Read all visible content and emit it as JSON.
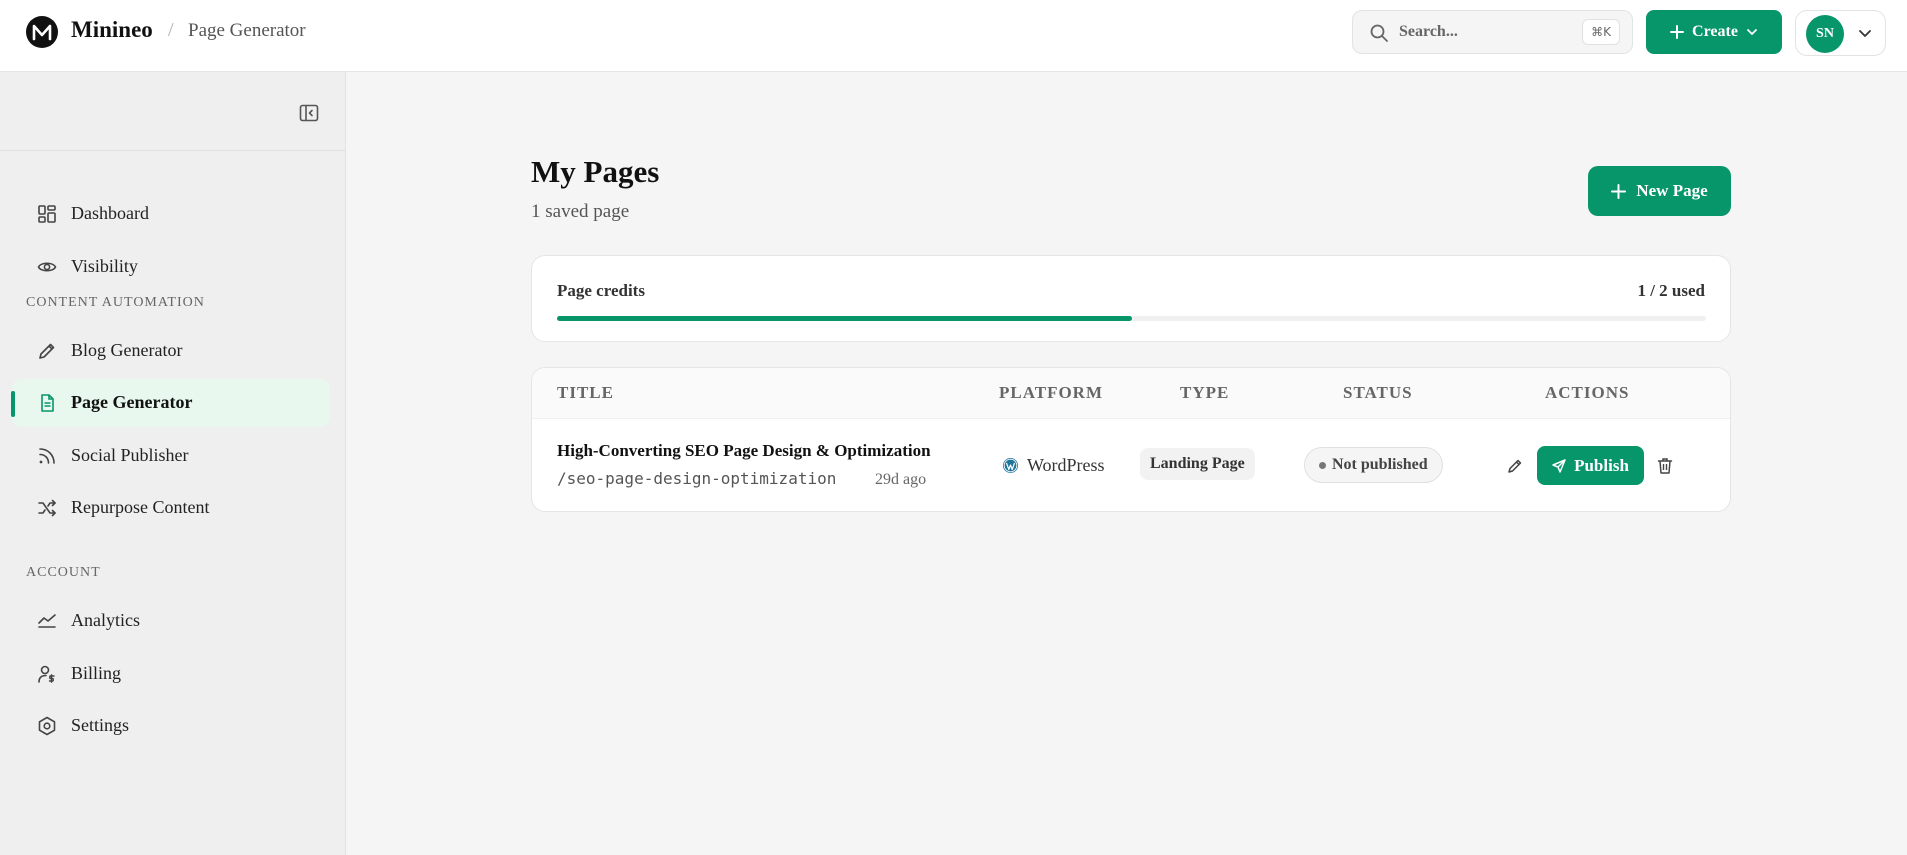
{
  "header": {
    "brand": "Minineo",
    "breadcrumb_separator": "/",
    "breadcrumb": "Page Generator",
    "search_placeholder": "Search...",
    "search_shortcut": "⌘K",
    "create_label": "Create",
    "avatar_initials": "SN"
  },
  "sidebar": {
    "main_items": [
      {
        "label": "Dashboard",
        "icon": "dashboard-icon"
      },
      {
        "label": "Visibility",
        "icon": "eye-icon"
      }
    ],
    "content_section_title": "CONTENT AUTOMATION",
    "content_items": [
      {
        "label": "Blog Generator",
        "icon": "pencil-icon"
      },
      {
        "label": "Page Generator",
        "icon": "file-text-icon",
        "active": true
      },
      {
        "label": "Social Publisher",
        "icon": "rss-icon"
      },
      {
        "label": "Repurpose Content",
        "icon": "shuffle-icon"
      }
    ],
    "account_section_title": "ACCOUNT",
    "account_items": [
      {
        "label": "Analytics",
        "icon": "chart-line-icon"
      },
      {
        "label": "Billing",
        "icon": "user-dollar-icon"
      },
      {
        "label": "Settings",
        "icon": "hexagon-settings-icon"
      }
    ]
  },
  "main": {
    "title": "My Pages",
    "subtitle": "1 saved page",
    "new_page_label": "New Page",
    "credits": {
      "label": "Page credits",
      "used_text": "1 / 2 used",
      "fraction_used": 0.5
    },
    "table": {
      "columns": [
        "TITLE",
        "PLATFORM",
        "TYPE",
        "STATUS",
        "ACTIONS"
      ],
      "rows": [
        {
          "title": "High-Converting SEO Page Design & Optimization",
          "slug": "/seo-page-design-optimization",
          "age": "29d ago",
          "platform": "WordPress",
          "type": "Landing Page",
          "status": "Not published",
          "publish_label": "Publish"
        }
      ]
    }
  },
  "colors": {
    "accent": "#079669",
    "active_bg": "#e9f8ef"
  }
}
